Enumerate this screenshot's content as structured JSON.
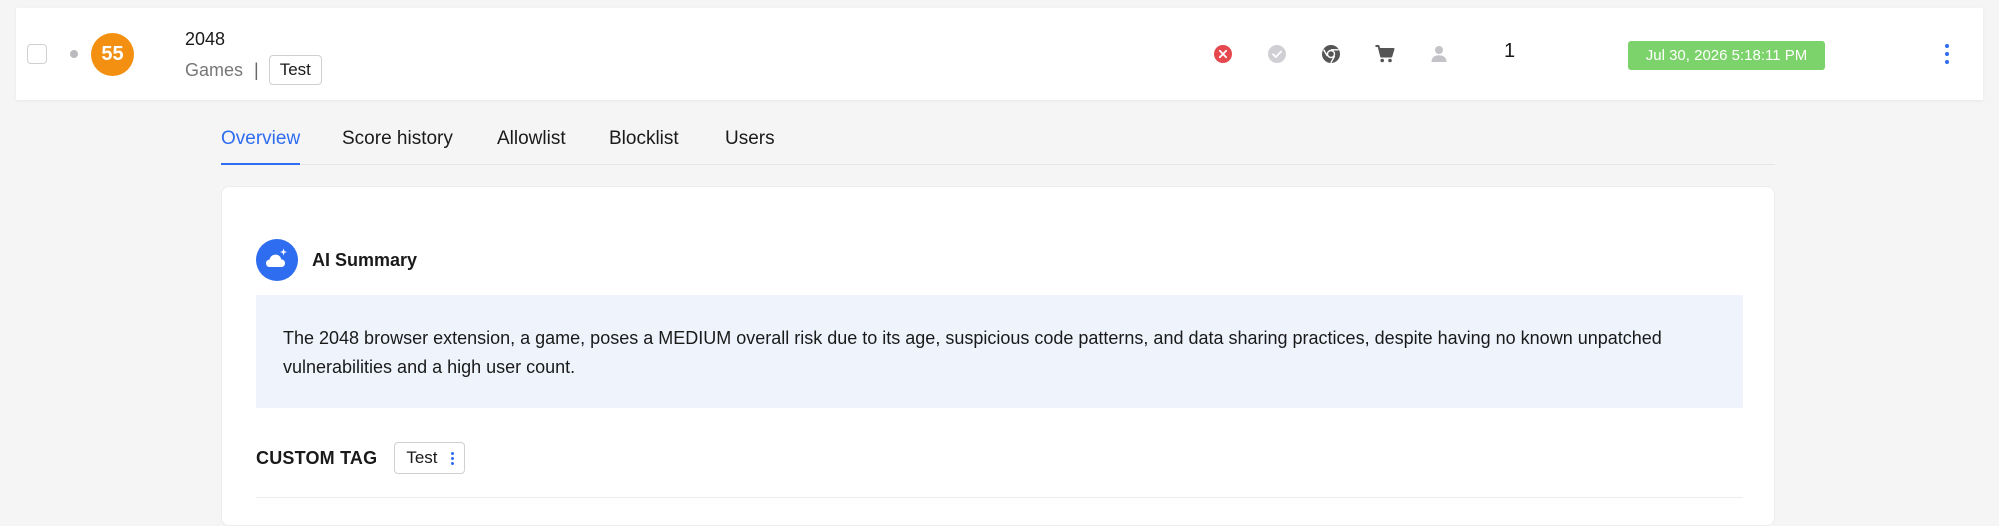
{
  "extension": {
    "name": "2048",
    "score": "55",
    "category": "Games",
    "separator": "|",
    "tag": "Test",
    "user_count": "1",
    "last_updated": "Jul 30, 2026 5:18:11 PM"
  },
  "status_icons": [
    {
      "name": "blocked-status-icon",
      "color": "#e5484d"
    },
    {
      "name": "approved-status-icon",
      "color": "#d0d0d4"
    },
    {
      "name": "chrome-browser-icon",
      "color": "#555555"
    },
    {
      "name": "store-cart-icon",
      "color": "#555555"
    },
    {
      "name": "user-icon",
      "color": "#c4c4c8"
    }
  ],
  "tabs": [
    {
      "label": "Overview",
      "active": true
    },
    {
      "label": "Score history",
      "active": false
    },
    {
      "label": "Allowlist",
      "active": false
    },
    {
      "label": "Blocklist",
      "active": false
    },
    {
      "label": "Users",
      "active": false
    }
  ],
  "ai_summary": {
    "title": "AI Summary",
    "text": "The 2048 browser extension, a game, poses a MEDIUM overall risk due to its age, suspicious code patterns, and data sharing practices, despite having no known unpatched vulnerabilities and a high user count."
  },
  "custom_tag": {
    "label": "CUSTOM TAG",
    "value": "Test"
  },
  "colors": {
    "accent": "#2f6df0",
    "score_badge": "#f39012",
    "date_badge": "#7dd36b",
    "summary_bg": "#eef3fc"
  }
}
